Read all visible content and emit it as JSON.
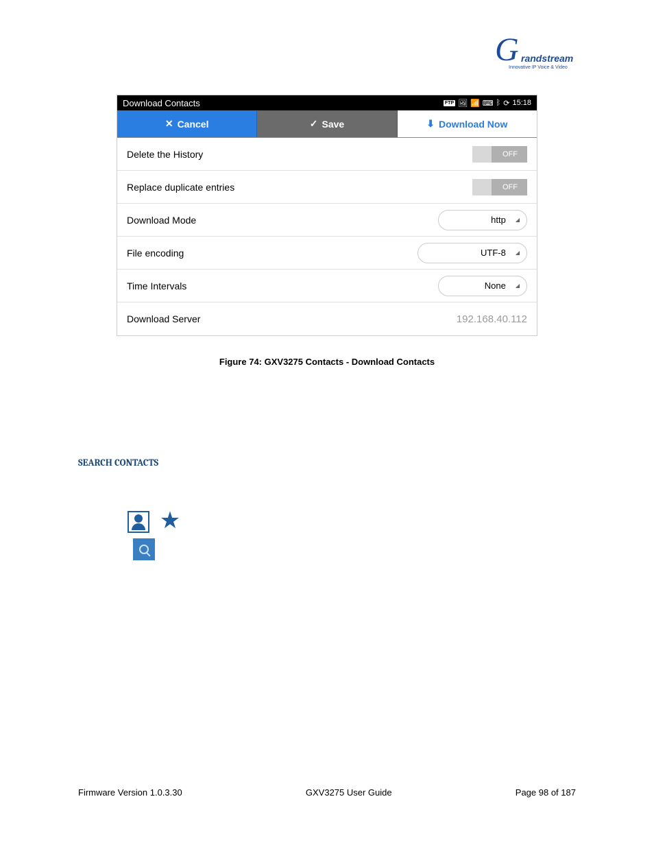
{
  "logo": {
    "brand": "Grandstream",
    "tagline": "Innovative IP Voice & Video"
  },
  "screenshot": {
    "statusbar": {
      "title": "Download Contacts",
      "ftp_badge": "FTP",
      "time": "15:18"
    },
    "actions": {
      "cancel": "Cancel",
      "save": "Save",
      "download_now": "Download Now"
    },
    "settings": [
      {
        "label": "Delete the History",
        "type": "toggle",
        "value": "OFF"
      },
      {
        "label": "Replace duplicate entries",
        "type": "toggle",
        "value": "OFF"
      },
      {
        "label": "Download Mode",
        "type": "spinner",
        "value": "http"
      },
      {
        "label": "File encoding",
        "type": "spinner_wide",
        "value": "UTF-8"
      },
      {
        "label": "Time Intervals",
        "type": "spinner",
        "value": "None"
      },
      {
        "label": "Download Server",
        "type": "text",
        "value": "192.168.40.112"
      }
    ]
  },
  "caption": "Figure 74: GXV3275 Contacts - Download Contacts",
  "section_heading": "SEARCH CONTACTS",
  "footer": {
    "firmware": "Firmware Version 1.0.3.30",
    "guide": "GXV3275 User Guide",
    "page": "Page 98 of 187"
  }
}
